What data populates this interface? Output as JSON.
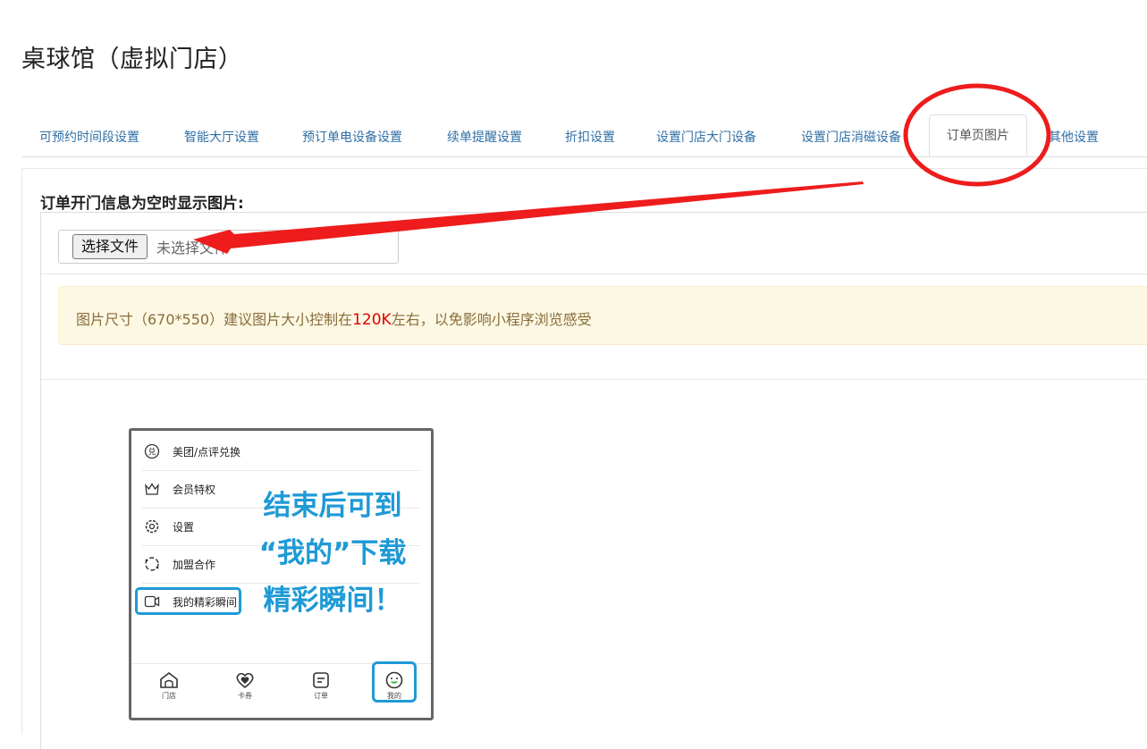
{
  "page": {
    "title": "桌球馆（虚拟门店）"
  },
  "tabs": [
    {
      "label": "可预约时间段设置"
    },
    {
      "label": "智能大厅设置"
    },
    {
      "label": "预订单电设备设置"
    },
    {
      "label": "续单提醒设置"
    },
    {
      "label": "折扣设置"
    },
    {
      "label": "设置门店大门设备"
    },
    {
      "label": "设置门店消磁设备"
    },
    {
      "label": "订单页图片",
      "active": true
    },
    {
      "label": "其他设置"
    }
  ],
  "section": {
    "label": "订单开门信息为空时显示图片:",
    "file_button": "选择文件",
    "file_status": "未选择文件"
  },
  "notice": {
    "text_before": "图片尺寸（670*550）建议图片大小控制在",
    "highlight": "120K",
    "text_after": "左右，以免影响小程序浏览感受",
    "highlight_color": "#e00000"
  },
  "preview": {
    "menu_items": [
      {
        "label": "美团/点评兑换",
        "icon": "exchange-icon"
      },
      {
        "label": "会员特权",
        "icon": "crown-icon"
      },
      {
        "label": "设置",
        "icon": "gear-icon"
      },
      {
        "label": "加盟合作",
        "icon": "join-icon"
      },
      {
        "label": "我的精彩瞬间",
        "icon": "video-icon"
      }
    ],
    "promo_lines": [
      "结束后可到",
      "“我的”下载",
      "精彩瞬间！"
    ],
    "tabbar": [
      {
        "label": "门店",
        "icon": "store-icon"
      },
      {
        "label": "卡券",
        "icon": "heart-icon"
      },
      {
        "label": "订单",
        "icon": "order-icon"
      },
      {
        "label": "我的",
        "icon": "smile-icon",
        "active": true
      }
    ],
    "accent_color": "#1e9ad6"
  },
  "annotations": {
    "color": "#ee1c1c"
  }
}
